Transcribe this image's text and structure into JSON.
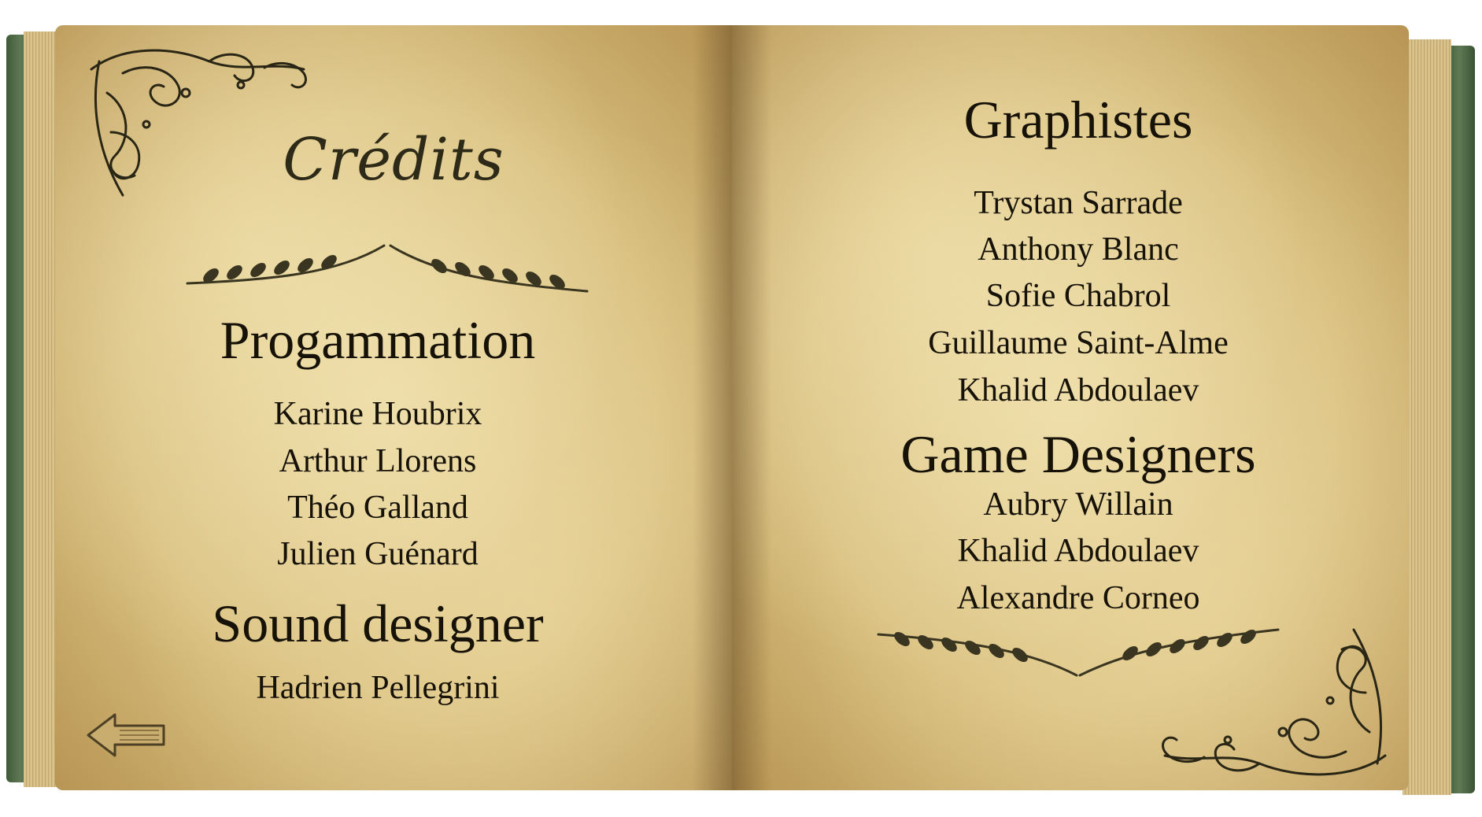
{
  "left_page": {
    "title": "Crédits",
    "programming": {
      "heading": "Progammation",
      "names": [
        "Karine Houbrix",
        "Arthur Llorens",
        "Théo Galland",
        "Julien Guénard"
      ]
    },
    "sound": {
      "heading": "Sound designer",
      "names": [
        "Hadrien Pellegrini"
      ]
    },
    "back_button": {
      "icon": "left-arrow-icon"
    }
  },
  "right_page": {
    "graphics": {
      "heading": "Graphistes",
      "names": [
        "Trystan Sarrade",
        "Anthony Blanc",
        "Sofie Chabrol",
        "Guillaume Saint-Alme",
        "Khalid Abdoulaev"
      ]
    },
    "game_design": {
      "heading": "Game Designers",
      "names": [
        "Aubry Willain",
        "Khalid Abdoulaev",
        "Alexandre Corneo"
      ]
    }
  },
  "colors": {
    "cover": "#4e6b45",
    "paper": "#dcc488",
    "ink": "#161208",
    "ornament": "#3a3520"
  },
  "icons": [
    "corner-ornament-icon",
    "laurel-divider-icon",
    "left-arrow-icon"
  ]
}
